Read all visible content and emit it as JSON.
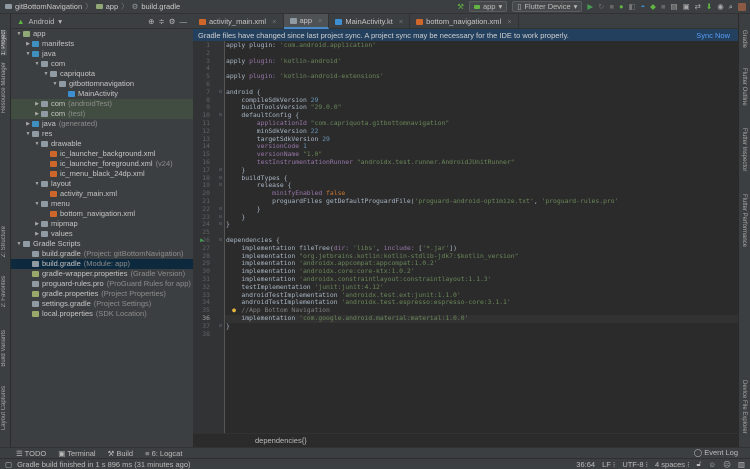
{
  "breadcrumb": [
    "gitBottomNavigation",
    "app",
    "build.gradle"
  ],
  "toolbar": {
    "run_config": "app",
    "device": "Flutter Device"
  },
  "left_strip": [
    "1: Project",
    "Resource Manager",
    "Z: Structure",
    "2: Favorites",
    "Build Variants",
    "Layout Captures"
  ],
  "right_strip": [
    "Gradle",
    "Flutter Outline",
    "Flutter Inspector",
    "Flutter Performance",
    "Device File Explorer"
  ],
  "project": {
    "view": "Android",
    "tree": [
      {
        "d": 0,
        "a": "▼",
        "i": "module",
        "c": "#8fa876",
        "label": "app"
      },
      {
        "d": 1,
        "a": "▶",
        "i": "folder",
        "c": "#3f8fbf",
        "label": "manifests"
      },
      {
        "d": 1,
        "a": "▼",
        "i": "folder",
        "c": "#3f8fbf",
        "label": "java"
      },
      {
        "d": 2,
        "a": "▼",
        "i": "package",
        "c": "#8f9aa3",
        "label": "com"
      },
      {
        "d": 3,
        "a": "▼",
        "i": "package",
        "c": "#8f9aa3",
        "label": "capriquota"
      },
      {
        "d": 4,
        "a": "▼",
        "i": "package",
        "c": "#8f9aa3",
        "label": "gitbottomnavigation"
      },
      {
        "d": 5,
        "a": "",
        "i": "kotlin-class",
        "c": "#3d8fd1",
        "label": "MainActivity"
      },
      {
        "d": 2,
        "a": "▶",
        "i": "package",
        "c": "#8f9aa3",
        "label": "com",
        "suffix": "(androidTest)",
        "hl": true
      },
      {
        "d": 2,
        "a": "▶",
        "i": "package",
        "c": "#8f9aa3",
        "label": "com",
        "suffix": "(test)",
        "hl": true
      },
      {
        "d": 1,
        "a": "▶",
        "i": "folder",
        "c": "#3f8fbf",
        "label": "java",
        "suffix": "(generated)"
      },
      {
        "d": 1,
        "a": "▼",
        "i": "res-folder",
        "c": "#8f9aa3",
        "label": "res"
      },
      {
        "d": 2,
        "a": "▼",
        "i": "folder",
        "c": "#8f9aa3",
        "label": "drawable"
      },
      {
        "d": 3,
        "a": "",
        "i": "xml",
        "c": "#d0672a",
        "label": "ic_launcher_background.xml"
      },
      {
        "d": 3,
        "a": "",
        "i": "xml",
        "c": "#d0672a",
        "label": "ic_launcher_foreground.xml",
        "suffix": "(v24)"
      },
      {
        "d": 3,
        "a": "",
        "i": "xml",
        "c": "#d0672a",
        "label": "ic_menu_black_24dp.xml"
      },
      {
        "d": 2,
        "a": "▼",
        "i": "folder",
        "c": "#8f9aa3",
        "label": "layout"
      },
      {
        "d": 3,
        "a": "",
        "i": "xml",
        "c": "#d0672a",
        "label": "activity_main.xml"
      },
      {
        "d": 2,
        "a": "▼",
        "i": "folder",
        "c": "#8f9aa3",
        "label": "menu"
      },
      {
        "d": 3,
        "a": "",
        "i": "xml",
        "c": "#d0672a",
        "label": "bottom_navigation.xml"
      },
      {
        "d": 2,
        "a": "▶",
        "i": "folder",
        "c": "#8f9aa3",
        "label": "mipmap"
      },
      {
        "d": 2,
        "a": "▶",
        "i": "folder",
        "c": "#8f9aa3",
        "label": "values"
      },
      {
        "d": 0,
        "a": "▼",
        "i": "gradle",
        "c": "#8f9aa3",
        "label": "Gradle Scripts"
      },
      {
        "d": 1,
        "a": "",
        "i": "gradle",
        "c": "#8f9aa3",
        "label": "build.gradle",
        "suffix": "(Project: gitBottomNavigation)"
      },
      {
        "d": 1,
        "a": "",
        "i": "gradle",
        "c": "#8f9aa3",
        "label": "build.gradle",
        "suffix": "(Module: app)",
        "sel": true
      },
      {
        "d": 1,
        "a": "",
        "i": "properties",
        "c": "#9aa86b",
        "label": "gradle-wrapper.properties",
        "suffix": "(Gradle Version)"
      },
      {
        "d": 1,
        "a": "",
        "i": "file",
        "c": "#8f9aa3",
        "label": "proguard-rules.pro",
        "suffix": "(ProGuard Rules for app)"
      },
      {
        "d": 1,
        "a": "",
        "i": "properties",
        "c": "#9aa86b",
        "label": "gradle.properties",
        "suffix": "(Project Properties)"
      },
      {
        "d": 1,
        "a": "",
        "i": "gradle",
        "c": "#8f9aa3",
        "label": "settings.gradle",
        "suffix": "(Project Settings)"
      },
      {
        "d": 1,
        "a": "",
        "i": "properties",
        "c": "#9aa86b",
        "label": "local.properties",
        "suffix": "(SDK Location)"
      }
    ]
  },
  "tabs": [
    {
      "label": "activity_main.xml",
      "c": "#d0672a"
    },
    {
      "label": "app",
      "c": "#8f9aa3",
      "active": true
    },
    {
      "label": "MainActivity.kt",
      "c": "#3d8fd1"
    },
    {
      "label": "bottom_navigation.xml",
      "c": "#d0672a"
    }
  ],
  "banner": {
    "message": "Gradle files have changed since last project sync. A project sync may be necessary for the IDE to work properly.",
    "action": "Sync Now"
  },
  "editor": {
    "current_line": 36,
    "lines": [
      [
        [
          "apply plugin: ",
          ""
        ],
        [
          "'com.android.application'",
          "str"
        ]
      ],
      [],
      [
        [
          "apply ",
          ""
        ],
        [
          "plugin: ",
          "prop"
        ],
        [
          "'kotlin-android'",
          "str"
        ]
      ],
      [],
      [
        [
          "apply ",
          ""
        ],
        [
          "plugin: ",
          "prop"
        ],
        [
          "'kotlin-android-extensions'",
          "str"
        ]
      ],
      [],
      [
        [
          "android {",
          ""
        ]
      ],
      [
        [
          "    compileSdkVersion ",
          ""
        ],
        [
          "29",
          "num"
        ]
      ],
      [
        [
          "    buildToolsVersion ",
          ""
        ],
        [
          "\"29.0.0\"",
          "str"
        ]
      ],
      [
        [
          "    defaultConfig {",
          ""
        ]
      ],
      [
        [
          "        applicationId ",
          "prop"
        ],
        [
          "\"com.capriquota.gitbottomnavigation\"",
          "str"
        ]
      ],
      [
        [
          "        minSdkVersion ",
          ""
        ],
        [
          "22",
          "num"
        ]
      ],
      [
        [
          "        targetSdkVersion ",
          ""
        ],
        [
          "29",
          "num"
        ]
      ],
      [
        [
          "        versionCode ",
          "prop"
        ],
        [
          "1",
          "num"
        ]
      ],
      [
        [
          "        versionName ",
          "prop"
        ],
        [
          "\"1.0\"",
          "str"
        ]
      ],
      [
        [
          "        testInstrumentationRunner ",
          "prop"
        ],
        [
          "\"androidx.test.runner.AndroidJUnitRunner\"",
          "str"
        ]
      ],
      [
        [
          "    }",
          ""
        ]
      ],
      [
        [
          "    buildTypes {",
          ""
        ]
      ],
      [
        [
          "        release {",
          ""
        ]
      ],
      [
        [
          "            minifyEnabled ",
          "prop"
        ],
        [
          "false",
          "kw"
        ]
      ],
      [
        [
          "            proguardFiles getDefaultProguardFile(",
          ""
        ],
        [
          "'proguard-android-optimize.txt'",
          "str"
        ],
        [
          ", ",
          ""
        ],
        [
          "'proguard-rules.pro'",
          "str"
        ]
      ],
      [
        [
          "        }",
          ""
        ]
      ],
      [
        [
          "    }",
          ""
        ]
      ],
      [
        [
          "}",
          ""
        ]
      ],
      [],
      [
        [
          "dependencies {",
          ""
        ]
      ],
      [
        [
          "    implementation fileTree(",
          ""
        ],
        [
          "dir: ",
          "prop"
        ],
        [
          "'libs'",
          "str"
        ],
        [
          ", ",
          ""
        ],
        [
          "include: ",
          "prop"
        ],
        [
          "[",
          ""
        ],
        [
          "'*.jar'",
          "str"
        ],
        [
          "])",
          ""
        ]
      ],
      [
        [
          "    implementation ",
          ""
        ],
        [
          "\"org.jetbrains.kotlin:kotlin-stdlib-jdk7:$kotlin_version\"",
          "str"
        ]
      ],
      [
        [
          "    implementation ",
          ""
        ],
        [
          "'androidx.appcompat:appcompat:1.0.2'",
          "str"
        ]
      ],
      [
        [
          "    implementation ",
          ""
        ],
        [
          "'androidx.core:core-ktx:1.0.2'",
          "str"
        ]
      ],
      [
        [
          "    implementation ",
          ""
        ],
        [
          "'androidx.constraintlayout:constraintlayout:1.1.3'",
          "str"
        ]
      ],
      [
        [
          "    testImplementation ",
          ""
        ],
        [
          "'junit:junit:4.12'",
          "str"
        ]
      ],
      [
        [
          "    androidTestImplementation ",
          ""
        ],
        [
          "'androidx.test.ext:junit:1.1.0'",
          "str"
        ]
      ],
      [
        [
          "    androidTestImplementation ",
          ""
        ],
        [
          "'androidx.test.espresso:espresso-core:3.1.1'",
          "str"
        ]
      ],
      [
        [
          "    //App Bottom Navigation",
          "com"
        ]
      ],
      [
        [
          "    implementation ",
          ""
        ],
        [
          "'com.google.android.material:material:1.0.0'",
          "str"
        ]
      ],
      [
        [
          "}",
          ""
        ]
      ],
      []
    ],
    "breadcrumb": "dependencies{}"
  },
  "tool_windows": [
    "TODO",
    "Terminal",
    "Build",
    "6: Logcat"
  ],
  "event_log": "Event Log",
  "status": {
    "message": "Gradle build finished in 1 s 896 ms (31 minutes ago)",
    "position": "36:64",
    "line_sep": "LF",
    "encoding": "UTF-8",
    "indent": "4 spaces"
  }
}
